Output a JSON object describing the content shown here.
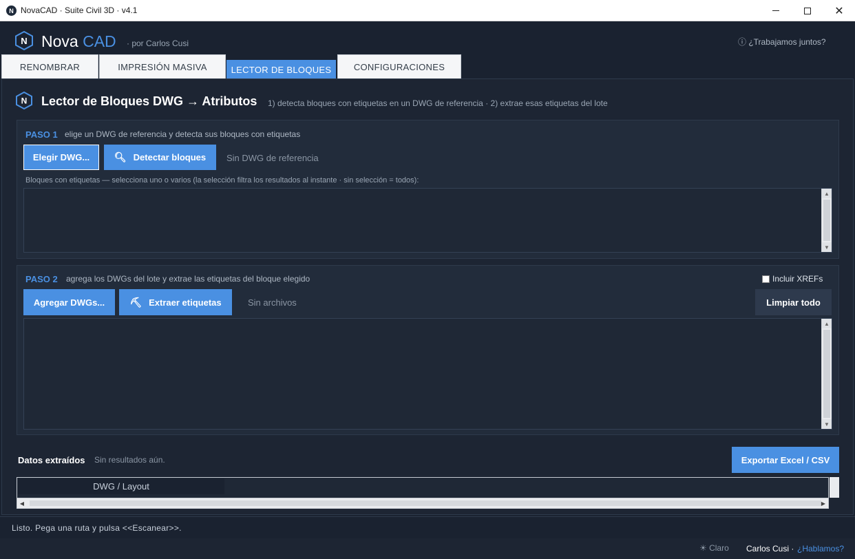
{
  "window": {
    "title": "NovaCAD · Suite Civil 3D · v4.1",
    "icon_letter": "N"
  },
  "header": {
    "brand_main": "Nova",
    "brand_accent": "CAD",
    "byline": "· por Carlos Cusi",
    "collab_link": "ⓘ ¿Trabajamos juntos?"
  },
  "tabs": [
    {
      "label": "RENOMBRAR",
      "active": false
    },
    {
      "label": "IMPRESIÓN MASIVA",
      "active": false
    },
    {
      "label": "LECTOR DE BLOQUES",
      "active": true
    },
    {
      "label": "CONFIGURACIONES",
      "active": false
    }
  ],
  "section": {
    "title": "Lector de Bloques  DWG → Atributos",
    "subtitle": "1) detecta bloques con etiquetas en un DWG de referencia · 2) extrae esas etiquetas del lote"
  },
  "step1": {
    "label": "PASO 1",
    "description": "elige un DWG de referencia y detecta sus bloques con etiquetas",
    "choose_button": "Elegir DWG...",
    "detect_button": "Detectar bloques",
    "status": "Sin DWG de referencia",
    "hint": "Bloques con etiquetas — selecciona uno o varios (la selección filtra los resultados al instante · sin selección = todos):"
  },
  "step2": {
    "label": "PASO 2",
    "description": "agrega los DWGs del lote y extrae las etiquetas del bloque elegido",
    "add_button": "Agregar DWGs...",
    "extract_button": "Extraer etiquetas",
    "status": "Sin archivos",
    "clear_button": "Limpiar todo",
    "xrefs_label": "Incluir XREFs",
    "xrefs_checked": false
  },
  "data": {
    "title": "Datos extraídos",
    "status": "Sin resultados aún.",
    "export_button": "Exportar Excel / CSV",
    "columns": [
      "DWG / Layout"
    ]
  },
  "statusbar": {
    "text": "Listo. Pega una ruta y pulsa <<Escanear>>."
  },
  "footer": {
    "theme": "☀ Claro",
    "author": "Carlos Cusi ·",
    "contact": "¿Hablamos?"
  },
  "colors": {
    "accent": "#4a90e2",
    "background": "#1a2230",
    "panel": "#222c3b"
  },
  "icons": {
    "app": "nova-hexagon-logo",
    "detect": "search-icon",
    "extract": "hammer-icon"
  }
}
